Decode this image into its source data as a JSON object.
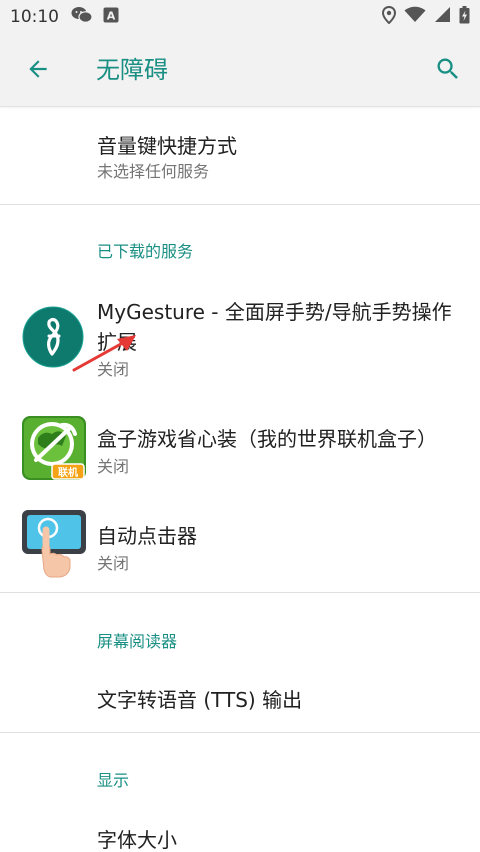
{
  "status_bar": {
    "time": "10:10",
    "left_icons": [
      "wechat-icon",
      "font-a-icon"
    ],
    "right_icons": [
      "location-icon",
      "wifi-icon",
      "signal-icon",
      "battery-icon"
    ]
  },
  "app_bar": {
    "title": "无障碍",
    "back_icon": "arrow-back-icon",
    "search_icon": "search-icon"
  },
  "volume_shortcut": {
    "title": "音量键快捷方式",
    "subtitle": "未选择任何服务"
  },
  "downloaded_services": {
    "header": "已下载的服务",
    "items": [
      {
        "title_line1": "MyGesture - 全面屏手势/导航手势操作",
        "title_line2": "扩展",
        "status": "关闭",
        "icon": "mygesture-app-icon"
      },
      {
        "title_line1": "盒子游戏省心装（我的世界联机盒子）",
        "status": "关闭",
        "icon": "minecraft-box-app-icon",
        "icon_badge": "联机"
      },
      {
        "title_line1": "自动点击器",
        "status": "关闭",
        "icon": "auto-clicker-app-icon"
      }
    ]
  },
  "screen_reader": {
    "header": "屏幕阅读器",
    "items": [
      {
        "title": "文字转语音 (TTS) 输出"
      }
    ]
  },
  "display": {
    "header": "显示",
    "items": [
      {
        "title": "字体大小"
      }
    ]
  },
  "colors": {
    "accent": "#1a8f84",
    "bar_background": "#f2f2f2",
    "divider": "#e0e0e0",
    "annotation_arrow": "#e53935"
  }
}
